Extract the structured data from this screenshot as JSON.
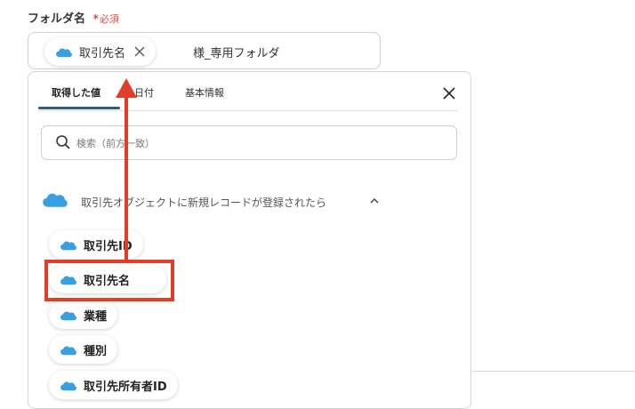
{
  "field": {
    "label": "フォルダ名",
    "required_star": "*",
    "required_text": "必須",
    "chip_label": "取引先名",
    "text_after_chip": "様_専用フォルダ"
  },
  "tabs": [
    {
      "label": "取得した値"
    },
    {
      "label": "日付"
    },
    {
      "label": "基本情報"
    }
  ],
  "search": {
    "placeholder": "検索（前方一致）"
  },
  "section": {
    "title": "取引先オブジェクトに新規レコードが登録されたら"
  },
  "items": [
    {
      "label": "取引先ID"
    },
    {
      "label": "取引先名"
    },
    {
      "label": "業種"
    },
    {
      "label": "種別"
    },
    {
      "label": "取引先所有者ID"
    }
  ],
  "colors": {
    "accent": "#2c5f7a",
    "highlight": "#e23e27",
    "salesforce_blue": "#3a9fe0",
    "required": "#e04848"
  }
}
